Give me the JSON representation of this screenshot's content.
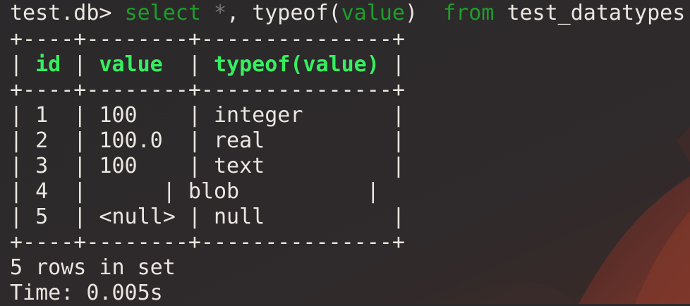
{
  "colors": {
    "background": "#2d2a2c",
    "text": "#ebe6e1",
    "keyword": "#1e9e2a",
    "header": "#35ef5f",
    "wallpaper_accent": "#7a2a26"
  },
  "prompt": "test.db>",
  "command": {
    "select": "select",
    "star": "*",
    "comma": ",",
    "func": "typeof(",
    "arg": "value",
    "close": ")",
    "from": "from",
    "table": "test_datatypes"
  },
  "table": {
    "border": "+----+--------+---------------+",
    "headers": [
      "id",
      "value",
      "typeof(value)"
    ],
    "rows": [
      {
        "id": "1",
        "value": "100",
        "type": "integer"
      },
      {
        "id": "2",
        "value": "100.0",
        "type": "real"
      },
      {
        "id": "3",
        "value": "100",
        "type": "text"
      },
      {
        "id": "4",
        "value": "",
        "type": "blob"
      },
      {
        "id": "5",
        "value": "<null>",
        "type": "null"
      }
    ]
  },
  "footer": {
    "row_count": "5 rows in set",
    "time": "Time: 0.005s"
  }
}
